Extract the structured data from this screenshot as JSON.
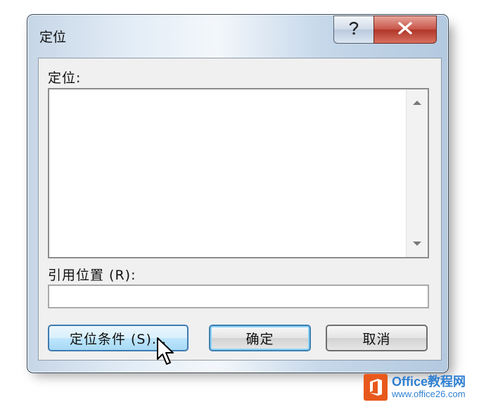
{
  "window": {
    "title": "定位",
    "help_glyph": "?",
    "close_glyph": "✕"
  },
  "goto": {
    "label": "定位:",
    "items": []
  },
  "reference": {
    "label": "引用位置 (R):",
    "value": ""
  },
  "buttons": {
    "special": "定位条件 (S)...",
    "ok": "确定",
    "cancel": "取消"
  },
  "watermark": {
    "line1": "Office教程网",
    "line2": "www.office26.com"
  },
  "colors": {
    "close_red": "#c8574a",
    "hot_blue": "#bee6fd",
    "watermark_orange": "#e8581c",
    "watermark_blue": "#2f7fd1"
  }
}
